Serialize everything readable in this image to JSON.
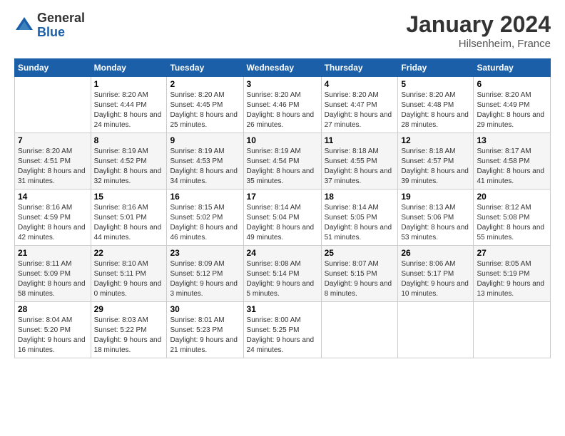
{
  "logo": {
    "general": "General",
    "blue": "Blue"
  },
  "header": {
    "title": "January 2024",
    "location": "Hilsenheim, France"
  },
  "days_of_week": [
    "Sunday",
    "Monday",
    "Tuesday",
    "Wednesday",
    "Thursday",
    "Friday",
    "Saturday"
  ],
  "weeks": [
    [
      {
        "day": "",
        "sunrise": "",
        "sunset": "",
        "daylight": ""
      },
      {
        "day": "1",
        "sunrise": "Sunrise: 8:20 AM",
        "sunset": "Sunset: 4:44 PM",
        "daylight": "Daylight: 8 hours and 24 minutes."
      },
      {
        "day": "2",
        "sunrise": "Sunrise: 8:20 AM",
        "sunset": "Sunset: 4:45 PM",
        "daylight": "Daylight: 8 hours and 25 minutes."
      },
      {
        "day": "3",
        "sunrise": "Sunrise: 8:20 AM",
        "sunset": "Sunset: 4:46 PM",
        "daylight": "Daylight: 8 hours and 26 minutes."
      },
      {
        "day": "4",
        "sunrise": "Sunrise: 8:20 AM",
        "sunset": "Sunset: 4:47 PM",
        "daylight": "Daylight: 8 hours and 27 minutes."
      },
      {
        "day": "5",
        "sunrise": "Sunrise: 8:20 AM",
        "sunset": "Sunset: 4:48 PM",
        "daylight": "Daylight: 8 hours and 28 minutes."
      },
      {
        "day": "6",
        "sunrise": "Sunrise: 8:20 AM",
        "sunset": "Sunset: 4:49 PM",
        "daylight": "Daylight: 8 hours and 29 minutes."
      }
    ],
    [
      {
        "day": "7",
        "sunrise": "Sunrise: 8:20 AM",
        "sunset": "Sunset: 4:51 PM",
        "daylight": "Daylight: 8 hours and 31 minutes."
      },
      {
        "day": "8",
        "sunrise": "Sunrise: 8:19 AM",
        "sunset": "Sunset: 4:52 PM",
        "daylight": "Daylight: 8 hours and 32 minutes."
      },
      {
        "day": "9",
        "sunrise": "Sunrise: 8:19 AM",
        "sunset": "Sunset: 4:53 PM",
        "daylight": "Daylight: 8 hours and 34 minutes."
      },
      {
        "day": "10",
        "sunrise": "Sunrise: 8:19 AM",
        "sunset": "Sunset: 4:54 PM",
        "daylight": "Daylight: 8 hours and 35 minutes."
      },
      {
        "day": "11",
        "sunrise": "Sunrise: 8:18 AM",
        "sunset": "Sunset: 4:55 PM",
        "daylight": "Daylight: 8 hours and 37 minutes."
      },
      {
        "day": "12",
        "sunrise": "Sunrise: 8:18 AM",
        "sunset": "Sunset: 4:57 PM",
        "daylight": "Daylight: 8 hours and 39 minutes."
      },
      {
        "day": "13",
        "sunrise": "Sunrise: 8:17 AM",
        "sunset": "Sunset: 4:58 PM",
        "daylight": "Daylight: 8 hours and 41 minutes."
      }
    ],
    [
      {
        "day": "14",
        "sunrise": "Sunrise: 8:16 AM",
        "sunset": "Sunset: 4:59 PM",
        "daylight": "Daylight: 8 hours and 42 minutes."
      },
      {
        "day": "15",
        "sunrise": "Sunrise: 8:16 AM",
        "sunset": "Sunset: 5:01 PM",
        "daylight": "Daylight: 8 hours and 44 minutes."
      },
      {
        "day": "16",
        "sunrise": "Sunrise: 8:15 AM",
        "sunset": "Sunset: 5:02 PM",
        "daylight": "Daylight: 8 hours and 46 minutes."
      },
      {
        "day": "17",
        "sunrise": "Sunrise: 8:14 AM",
        "sunset": "Sunset: 5:04 PM",
        "daylight": "Daylight: 8 hours and 49 minutes."
      },
      {
        "day": "18",
        "sunrise": "Sunrise: 8:14 AM",
        "sunset": "Sunset: 5:05 PM",
        "daylight": "Daylight: 8 hours and 51 minutes."
      },
      {
        "day": "19",
        "sunrise": "Sunrise: 8:13 AM",
        "sunset": "Sunset: 5:06 PM",
        "daylight": "Daylight: 8 hours and 53 minutes."
      },
      {
        "day": "20",
        "sunrise": "Sunrise: 8:12 AM",
        "sunset": "Sunset: 5:08 PM",
        "daylight": "Daylight: 8 hours and 55 minutes."
      }
    ],
    [
      {
        "day": "21",
        "sunrise": "Sunrise: 8:11 AM",
        "sunset": "Sunset: 5:09 PM",
        "daylight": "Daylight: 8 hours and 58 minutes."
      },
      {
        "day": "22",
        "sunrise": "Sunrise: 8:10 AM",
        "sunset": "Sunset: 5:11 PM",
        "daylight": "Daylight: 9 hours and 0 minutes."
      },
      {
        "day": "23",
        "sunrise": "Sunrise: 8:09 AM",
        "sunset": "Sunset: 5:12 PM",
        "daylight": "Daylight: 9 hours and 3 minutes."
      },
      {
        "day": "24",
        "sunrise": "Sunrise: 8:08 AM",
        "sunset": "Sunset: 5:14 PM",
        "daylight": "Daylight: 9 hours and 5 minutes."
      },
      {
        "day": "25",
        "sunrise": "Sunrise: 8:07 AM",
        "sunset": "Sunset: 5:15 PM",
        "daylight": "Daylight: 9 hours and 8 minutes."
      },
      {
        "day": "26",
        "sunrise": "Sunrise: 8:06 AM",
        "sunset": "Sunset: 5:17 PM",
        "daylight": "Daylight: 9 hours and 10 minutes."
      },
      {
        "day": "27",
        "sunrise": "Sunrise: 8:05 AM",
        "sunset": "Sunset: 5:19 PM",
        "daylight": "Daylight: 9 hours and 13 minutes."
      }
    ],
    [
      {
        "day": "28",
        "sunrise": "Sunrise: 8:04 AM",
        "sunset": "Sunset: 5:20 PM",
        "daylight": "Daylight: 9 hours and 16 minutes."
      },
      {
        "day": "29",
        "sunrise": "Sunrise: 8:03 AM",
        "sunset": "Sunset: 5:22 PM",
        "daylight": "Daylight: 9 hours and 18 minutes."
      },
      {
        "day": "30",
        "sunrise": "Sunrise: 8:01 AM",
        "sunset": "Sunset: 5:23 PM",
        "daylight": "Daylight: 9 hours and 21 minutes."
      },
      {
        "day": "31",
        "sunrise": "Sunrise: 8:00 AM",
        "sunset": "Sunset: 5:25 PM",
        "daylight": "Daylight: 9 hours and 24 minutes."
      },
      {
        "day": "",
        "sunrise": "",
        "sunset": "",
        "daylight": ""
      },
      {
        "day": "",
        "sunrise": "",
        "sunset": "",
        "daylight": ""
      },
      {
        "day": "",
        "sunrise": "",
        "sunset": "",
        "daylight": ""
      }
    ]
  ]
}
